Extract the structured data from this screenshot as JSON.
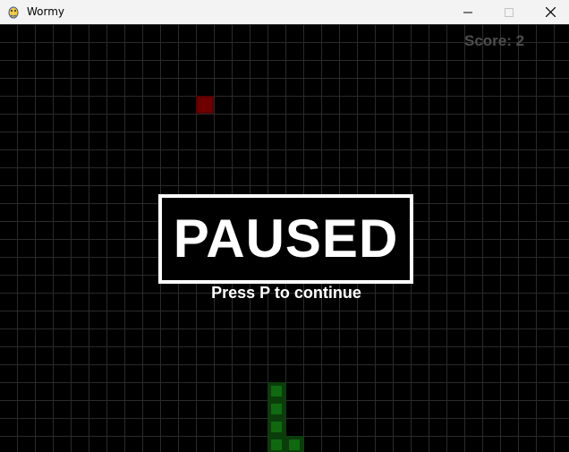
{
  "window": {
    "title": "Wormy",
    "icon": "pygame-snake-icon",
    "controls": {
      "minimize": "minimize-icon",
      "maximize": "maximize-icon",
      "close": "close-icon"
    }
  },
  "game": {
    "score_text": "Score: 2",
    "paused_text": "PAUSED",
    "continue_text": "Press P to continue",
    "colors": {
      "background": "#000000",
      "grid": "#2a2a2a",
      "apple": "#6e0000",
      "worm_outer": "#0a3d0a",
      "worm_inner": "#0f6a0f",
      "text": "#ffffff",
      "score": "#4d4d4d"
    }
  }
}
